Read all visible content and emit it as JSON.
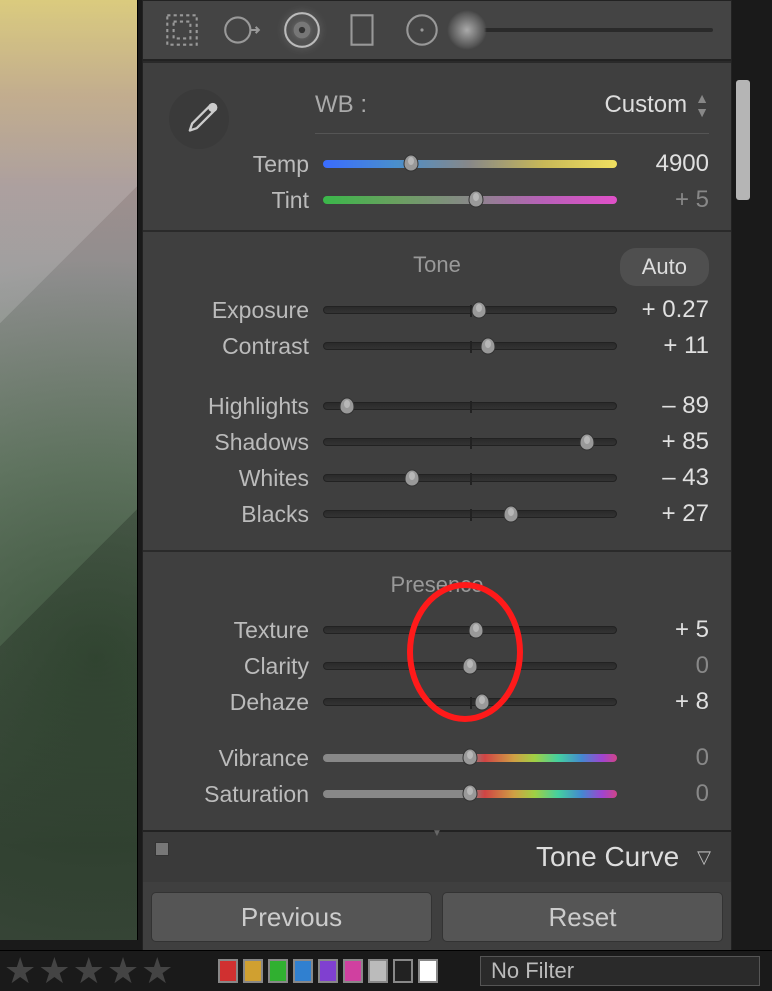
{
  "toolbar": {
    "tools": [
      "crop",
      "spot",
      "eye",
      "graduated",
      "radial",
      "brush"
    ]
  },
  "basic": {
    "wb_label": "WB :",
    "wb_value": "Custom",
    "sliders": {
      "temp": {
        "label": "Temp",
        "value": "4900",
        "pos": 30,
        "track": "temp"
      },
      "tint": {
        "label": "Tint",
        "value": "+ 5",
        "pos": 52,
        "track": "tint",
        "dim": true
      }
    }
  },
  "tone": {
    "title": "Tone",
    "auto_label": "Auto",
    "sliders": {
      "exposure": {
        "label": "Exposure",
        "value": "+ 0.27",
        "pos": 53
      },
      "contrast": {
        "label": "Contrast",
        "value": "+ 11",
        "pos": 56
      }
    },
    "sliders2": {
      "highlights": {
        "label": "Highlights",
        "value": "– 89",
        "pos": 8
      },
      "shadows": {
        "label": "Shadows",
        "value": "+ 85",
        "pos": 90
      },
      "whites": {
        "label": "Whites",
        "value": "– 43",
        "pos": 30
      },
      "blacks": {
        "label": "Blacks",
        "value": "+ 27",
        "pos": 64
      }
    }
  },
  "presence": {
    "title": "Presence",
    "sliders": {
      "texture": {
        "label": "Texture",
        "value": "+ 5",
        "pos": 52
      },
      "clarity": {
        "label": "Clarity",
        "value": "0",
        "pos": 50,
        "dim": true
      },
      "dehaze": {
        "label": "Dehaze",
        "value": "+ 8",
        "pos": 54
      }
    },
    "sliders2": {
      "vibrance": {
        "label": "Vibrance",
        "value": "0",
        "pos": 50,
        "dim": true,
        "track": "rainbow"
      },
      "saturation": {
        "label": "Saturation",
        "value": "0",
        "pos": 50,
        "dim": true,
        "track": "rainbow"
      }
    }
  },
  "tonecurve": {
    "label": "Tone Curve"
  },
  "buttons": {
    "previous": "Previous",
    "reset": "Reset"
  },
  "footer": {
    "colors": [
      "#d03030",
      "#d0a030",
      "#30b030",
      "#3080d0",
      "#8040d0",
      "#d040a0",
      "#bbbbbb",
      "#222222",
      "#ffffff"
    ],
    "filter_label": "No Filter"
  }
}
